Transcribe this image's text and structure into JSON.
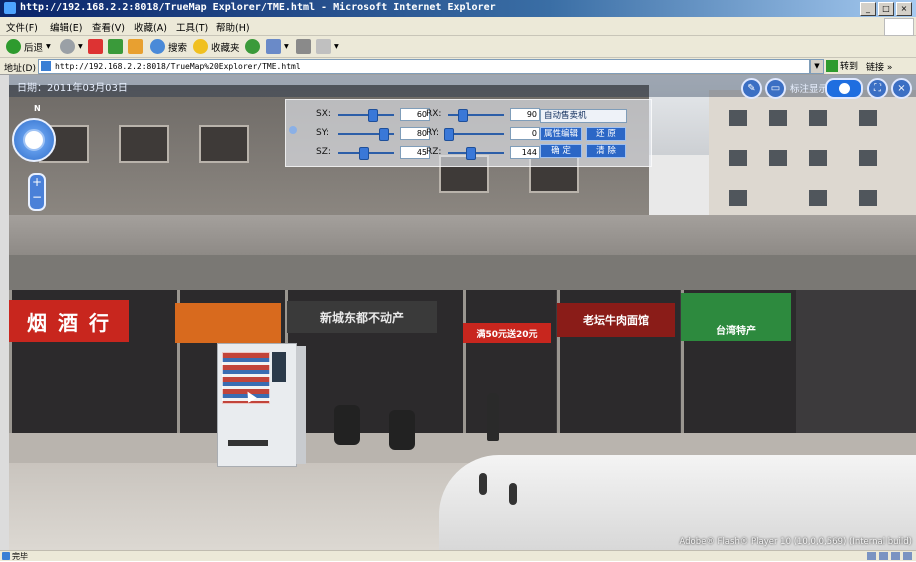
{
  "window": {
    "title": "http://192.168.2.2:8018/TrueMap Explorer/TME.html - Microsoft Internet Explorer"
  },
  "menu": [
    "文件(F)",
    "编辑(E)",
    "查看(V)",
    "收藏(A)",
    "工具(T)",
    "帮助(H)"
  ],
  "toolbar": {
    "back": "后退",
    "search": "搜索",
    "favorites": "收藏夹"
  },
  "address": {
    "label": "地址(D)",
    "url": "http://192.168.2.2:8018/TrueMap%20Explorer/TME.html",
    "go": "转到",
    "links": "链接"
  },
  "viewer": {
    "date": "日期：2011年03月03日",
    "label_show": "标注显示",
    "nav_north": "N",
    "zoom_in": "+",
    "zoom_out": "−",
    "flash_note": "Adobe® Flash® Player 10 (10,0,0,569) (Internal build)"
  },
  "panel": {
    "sliders": [
      {
        "label": "SX:",
        "value": "60",
        "level": 0.6
      },
      {
        "label": "SY:",
        "value": "80",
        "level": 0.8
      },
      {
        "label": "SZ:",
        "value": "45",
        "level": 0.45
      },
      {
        "label": "RX:",
        "value": "90",
        "level": 0.25
      },
      {
        "label": "RY:",
        "value": "0",
        "level": 0.0
      },
      {
        "label": "RZ:",
        "value": "144",
        "level": 0.4
      }
    ],
    "select_label": "自动售卖机",
    "btn_edit": "属性编辑",
    "btn_restore": "还 原",
    "btn_ok": "确 定",
    "btn_clear": "清 除"
  },
  "signs": {
    "shop1": "烟 酒 行",
    "shop2": "新城东都不动产",
    "shop3": "满50元送20元",
    "shop4": "老坛牛肉面馆",
    "shop5": "台湾特产"
  },
  "status": {
    "text": "完毕"
  }
}
